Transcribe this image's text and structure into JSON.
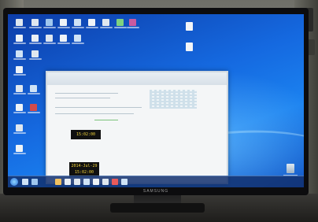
{
  "monitor": {
    "brand": "SAMSUNG"
  },
  "window": {
    "clock_small": "15:02:00",
    "clock_date": "2014-Jul-29",
    "clock_time": "15:02:00"
  },
  "taskbar": {
    "tray_time": "",
    "tray_date": ""
  },
  "icons": {
    "desktop_top_row": [
      "app-icon",
      "app-icon",
      "app-icon",
      "app-icon",
      "app-icon",
      "app-icon",
      "app-icon",
      "app-icon"
    ],
    "colors": {
      "accent_blue": "#1569e0",
      "clock_bg": "#101010",
      "clock_fg": "#f0d23a"
    }
  }
}
